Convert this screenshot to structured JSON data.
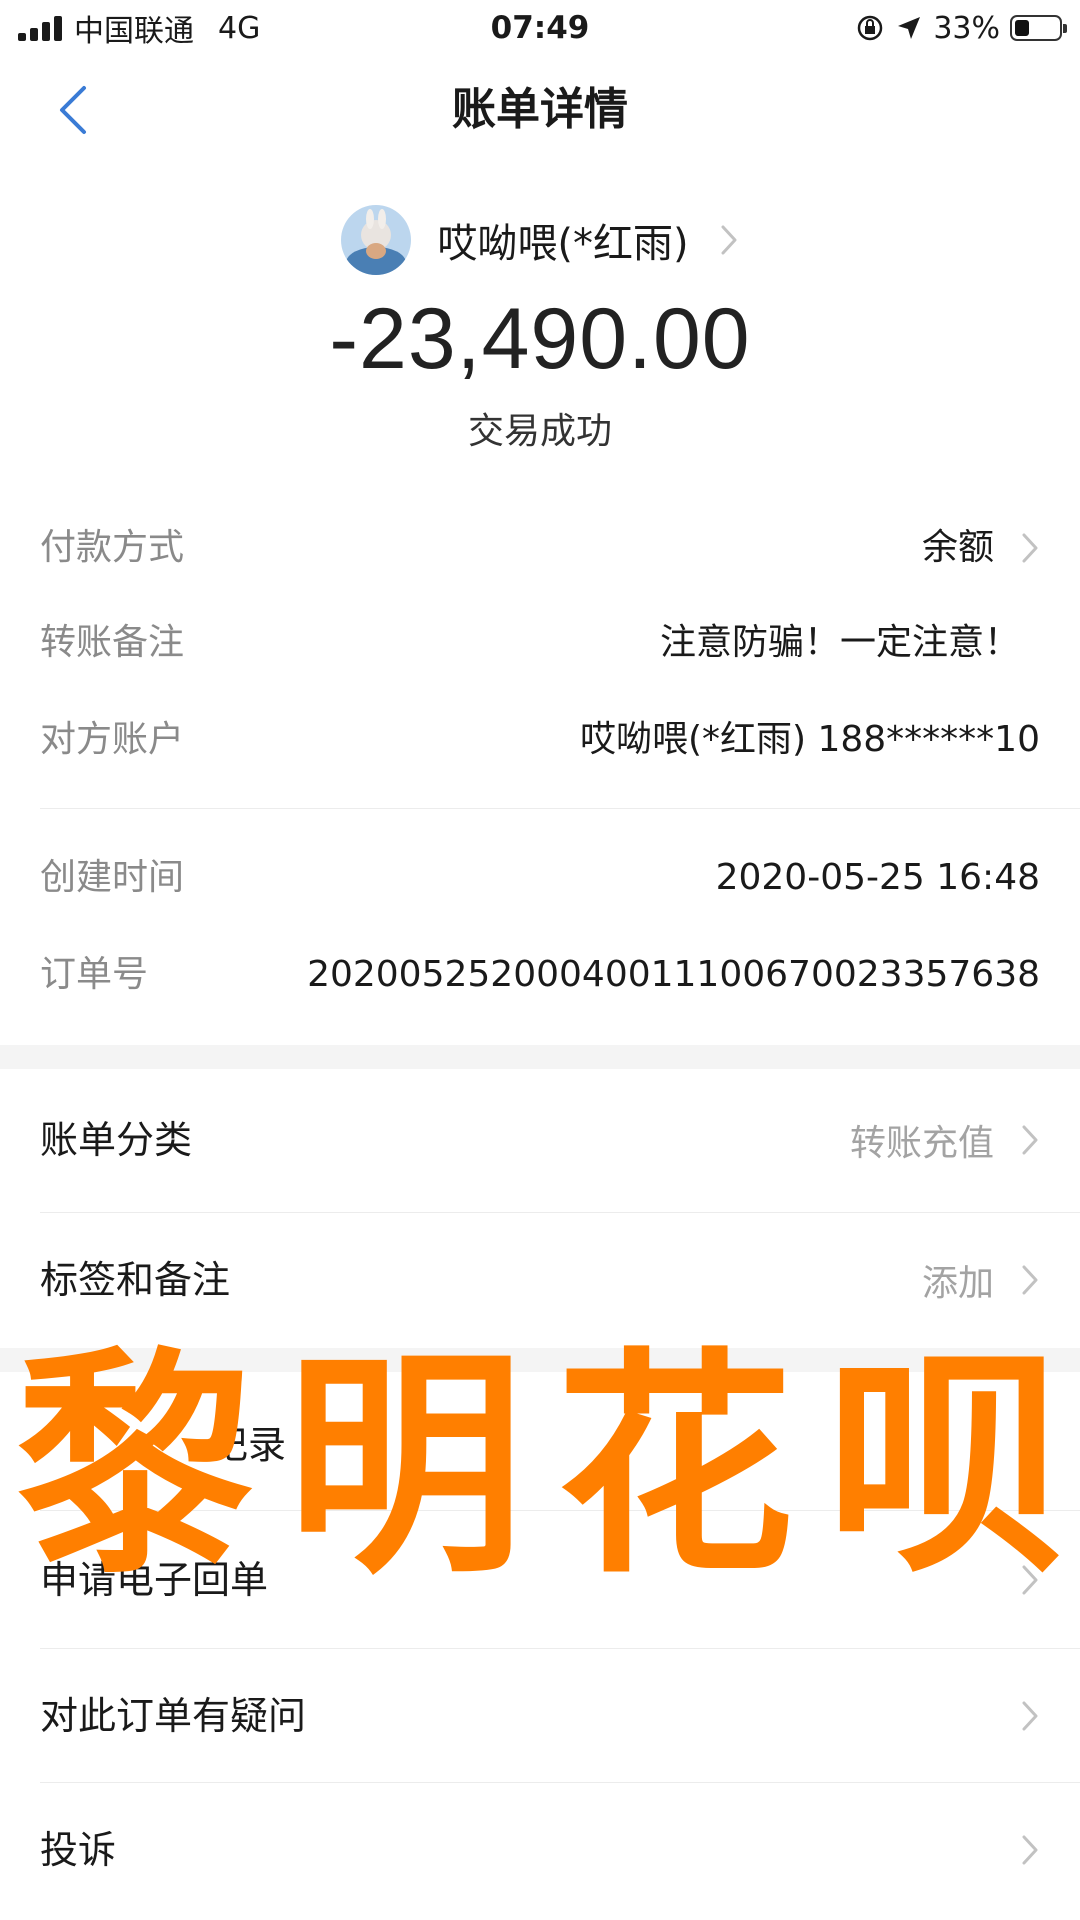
{
  "status_bar": {
    "carrier": "中国联通",
    "network": "4G",
    "time": "07:49",
    "battery": "33%",
    "battery_level": 0.33
  },
  "nav": {
    "title": "账单详情",
    "back_icon": "chevron-left-icon"
  },
  "header": {
    "payee_name": "哎呦喂(*红雨)",
    "amount": "-23,490.00",
    "status": "交易成功"
  },
  "details": [
    {
      "label": "付款方式",
      "value": "余额"
    },
    {
      "label": "转账备注",
      "value": "注意防骗！一定注意！"
    },
    {
      "label": "对方账户",
      "value": "哎呦喂(*红雨) 188******10"
    },
    {
      "label": "创建时间",
      "value": "2020-05-25 16:48"
    },
    {
      "label": "订单号",
      "value": "20200525200040011100670023357638"
    }
  ],
  "list": [
    {
      "label": "账单分类",
      "value": "转账充值"
    },
    {
      "label": "标签和备注",
      "value": "添加"
    },
    {
      "label": "记录",
      "value": ""
    },
    {
      "label": "申请电子回单",
      "value": ""
    },
    {
      "label": "对此订单有疑问",
      "value": ""
    },
    {
      "label": "投诉",
      "value": ""
    }
  ],
  "watermark": [
    "黎",
    "明",
    "花",
    "呗"
  ],
  "colors": {
    "accent": "#3a7bd5",
    "watermark": "#ff7f00",
    "label_gray": "#8a8a8a"
  }
}
